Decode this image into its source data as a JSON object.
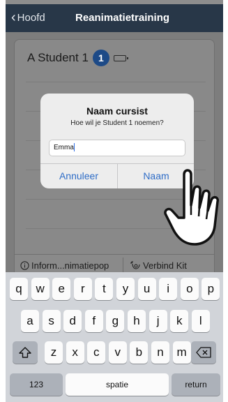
{
  "navbar": {
    "back_label": "Hoofd",
    "title": "Reanimatietraining"
  },
  "student": {
    "name": "A Student 1",
    "badge": "1",
    "battery_level": 1.0
  },
  "tabs": {
    "info_label": "Inform...nimatiepop",
    "connect_label": "Verbind Kit"
  },
  "dialog": {
    "title": "Naam cursist",
    "message": "Hoe wil je Student 1 noemen?",
    "input_value": "Emma",
    "cancel_label": "Annuleer",
    "confirm_label": "Naam"
  },
  "keyboard": {
    "row1": [
      "q",
      "w",
      "e",
      "r",
      "t",
      "y",
      "u",
      "i",
      "o",
      "p"
    ],
    "row2": [
      "a",
      "s",
      "d",
      "f",
      "g",
      "h",
      "j",
      "k",
      "l"
    ],
    "row3": [
      "z",
      "x",
      "c",
      "v",
      "b",
      "n",
      "m"
    ],
    "numbers_label": "123",
    "space_label": "spatie",
    "return_label": "return"
  }
}
